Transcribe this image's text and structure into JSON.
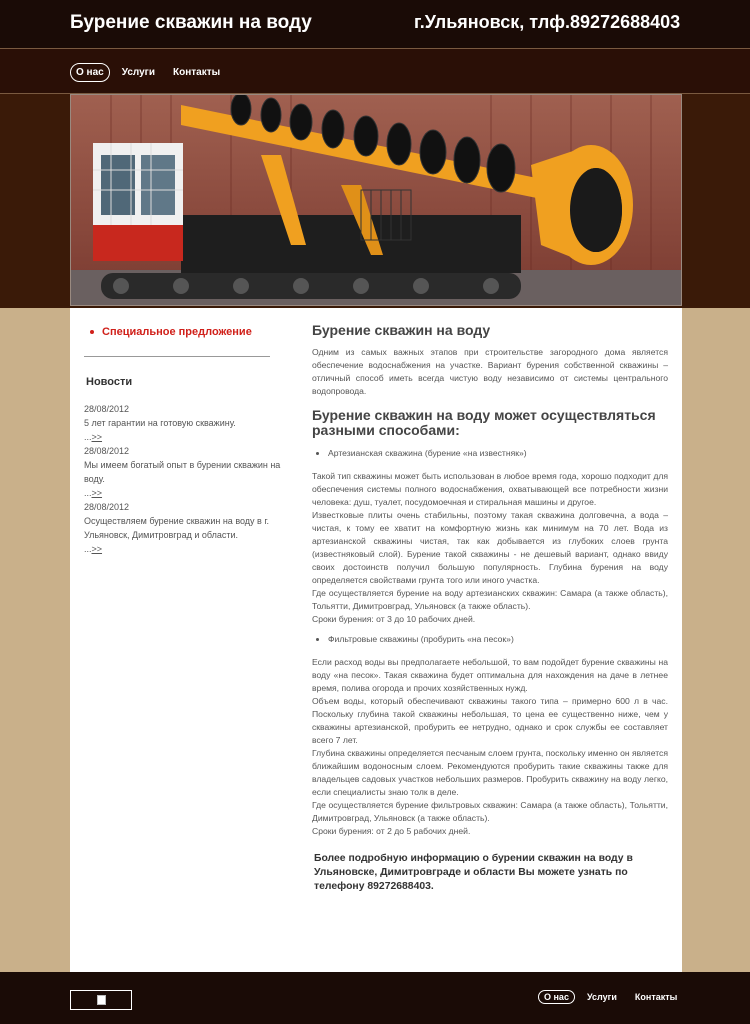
{
  "header": {
    "title": "Бурение скважин на воду",
    "phone": "г.Ульяновск, тлф.89272688403"
  },
  "nav": [
    {
      "label": "О нас",
      "active": true
    },
    {
      "label": "Услуги",
      "active": false
    },
    {
      "label": "Контакты",
      "active": false
    }
  ],
  "sidebar": {
    "special_offer": "Специальное предложение",
    "news_title": "Новости",
    "news": [
      {
        "date": "28/08/2012",
        "text": "5 лет гарантии на готовую скважину.",
        "more_prefix": "...",
        "more": ">>"
      },
      {
        "date": "28/08/2012",
        "text": "Мы имеем богатый опыт в бурении скважин на воду.",
        "more_prefix": "...",
        "more": ">>"
      },
      {
        "date": "28/08/2012",
        "text": "Осуществляем бурение скважин на воду в г. Ульяновск, Димитровград и области.",
        "more_prefix": "...",
        "more": ">>"
      }
    ]
  },
  "main": {
    "heading": "Бурение скважин на воду",
    "intro": "Одним из самых важных этапов при строительстве загородного дома является обеспечение водоснабжения на участке. Вариант бурения собственной скважины – отличный способ иметь всегда чистую воду независимо от системы центрального водопровода.",
    "subheading": "Бурение скважин на воду может осуществляться разными способами:",
    "method1": "Артезианская скважина (бурение «на известняк»)",
    "m1_p1": "Такой тип скважины может быть использован в любое время года, хорошо подходит для обеспечения системы полного водоснабжения, охватывающей все потребности жизни человека: душ, туалет, посудомоечная и стиральная машины и другое.",
    "m1_p2": "Известковые плиты очень стабильны, поэтому такая скважина долговечна, а вода – чистая, к тому ее хватит на комфортную жизнь как минимум на 70 лет. Вода из артезианской скважины чистая, так как добывается из глубоких слоев грунта (известняковый слой). Бурение такой скважины - не дешевый вариант, однако ввиду своих достоинств получил большую популярность. Глубина бурения на воду определяется свойствами грунта того или иного участка.",
    "m1_p3": "Где осуществляется бурение на воду артезианских скважин: Самара (а также область), Тольятти, Димитровград, Ульяновск (а также область).",
    "m1_p4": "Сроки бурения: от 3 до 10 рабочих дней.",
    "method2": "Фильтровые скважины (пробурить «на песок»)",
    "m2_p1": "Если расход воды вы предполагаете небольшой, то вам подойдет бурение скважины на воду «на песок». Такая скважина будет оптимальна для нахождения на даче в летнее время, полива огорода и прочих хозяйственных нужд.",
    "m2_p2": "Объем воды, который обеспечивают скважины такого типа – примерно 600 л в час. Поскольку глубина такой скважины небольшая, то цена ее существенно ниже, чем у скважины артезианской, пробурить ее нетрудно, однако и срок службы ее составляет всего 7 лет.",
    "m2_p3": "Глубина скважины определяется песчаным слоем грунта, поскольку именно он является ближайшим водоносным слоем. Рекомендуются пробурить такие скважины также для владельцев садовых участков небольших размеров. Пробурить скважину на воду легко, если специалисты знаю толк в деле.",
    "m2_p4": "Где осуществляется бурение фильтровых скважин: Самара (а также область), Тольятти, Димитровград, Ульяновск (а также область).",
    "m2_p5": "Сроки бурения: от 2 до 5 рабочих дней.",
    "closing": "Более подробную информацию о бурении скважин на воду в Ульяновске, Димитровграде и области Вы можете узнать по телефону 89272688403."
  },
  "footer_nav": [
    {
      "label": "О нас",
      "active": true
    },
    {
      "label": "Услуги",
      "active": false
    },
    {
      "label": "Контакты",
      "active": false
    }
  ],
  "colors": {
    "background": "#c9b08a",
    "header": "#1a0b06",
    "nav": "#2a0f06",
    "accent_red": "#d0201a",
    "auger_orange": "#f0a020"
  },
  "icons": {
    "bullet": "bullet-icon",
    "footer_image": "broken-image-icon"
  }
}
